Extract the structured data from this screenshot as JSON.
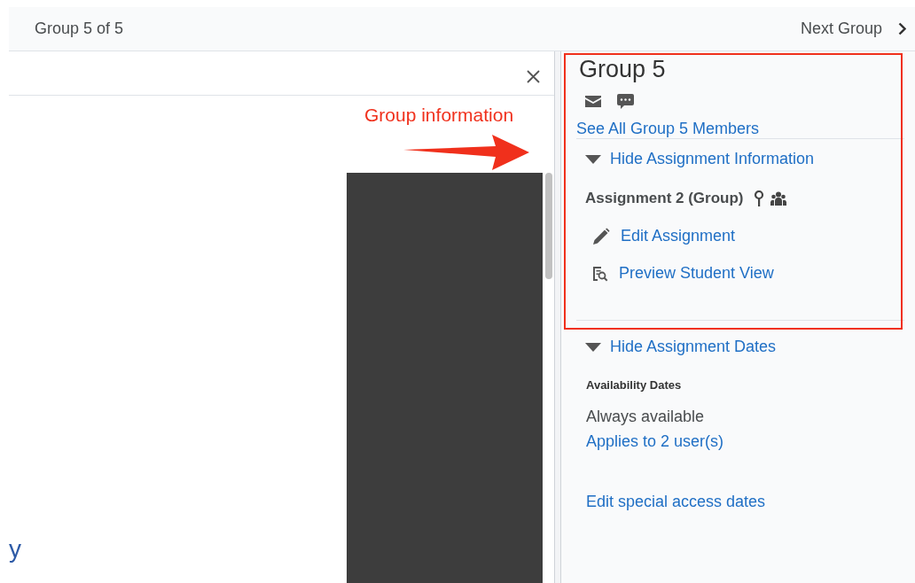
{
  "top_bar": {
    "title": "Group 5 of 5",
    "next_label": "Next Group"
  },
  "preview": {
    "partial_text": "y"
  },
  "annotation": {
    "text": "Group information"
  },
  "panel": {
    "title": "Group 5",
    "members_link": "See All Group 5 Members",
    "sections": [
      {
        "kind": "info",
        "toggle": "Hide Assignment Information",
        "expanded": true,
        "assignment": "Assignment 2 (Group)",
        "actions": [
          {
            "kind": "edit",
            "label": "Edit Assignment"
          },
          {
            "kind": "preview",
            "label": "Preview Student View"
          }
        ]
      },
      {
        "kind": "dates",
        "toggle": "Hide Assignment Dates",
        "expanded": true,
        "heading": "Availability Dates",
        "availability": "Always available",
        "applies_link": "Applies to 2 user(s)",
        "special_link": "Edit special access dates"
      }
    ]
  }
}
